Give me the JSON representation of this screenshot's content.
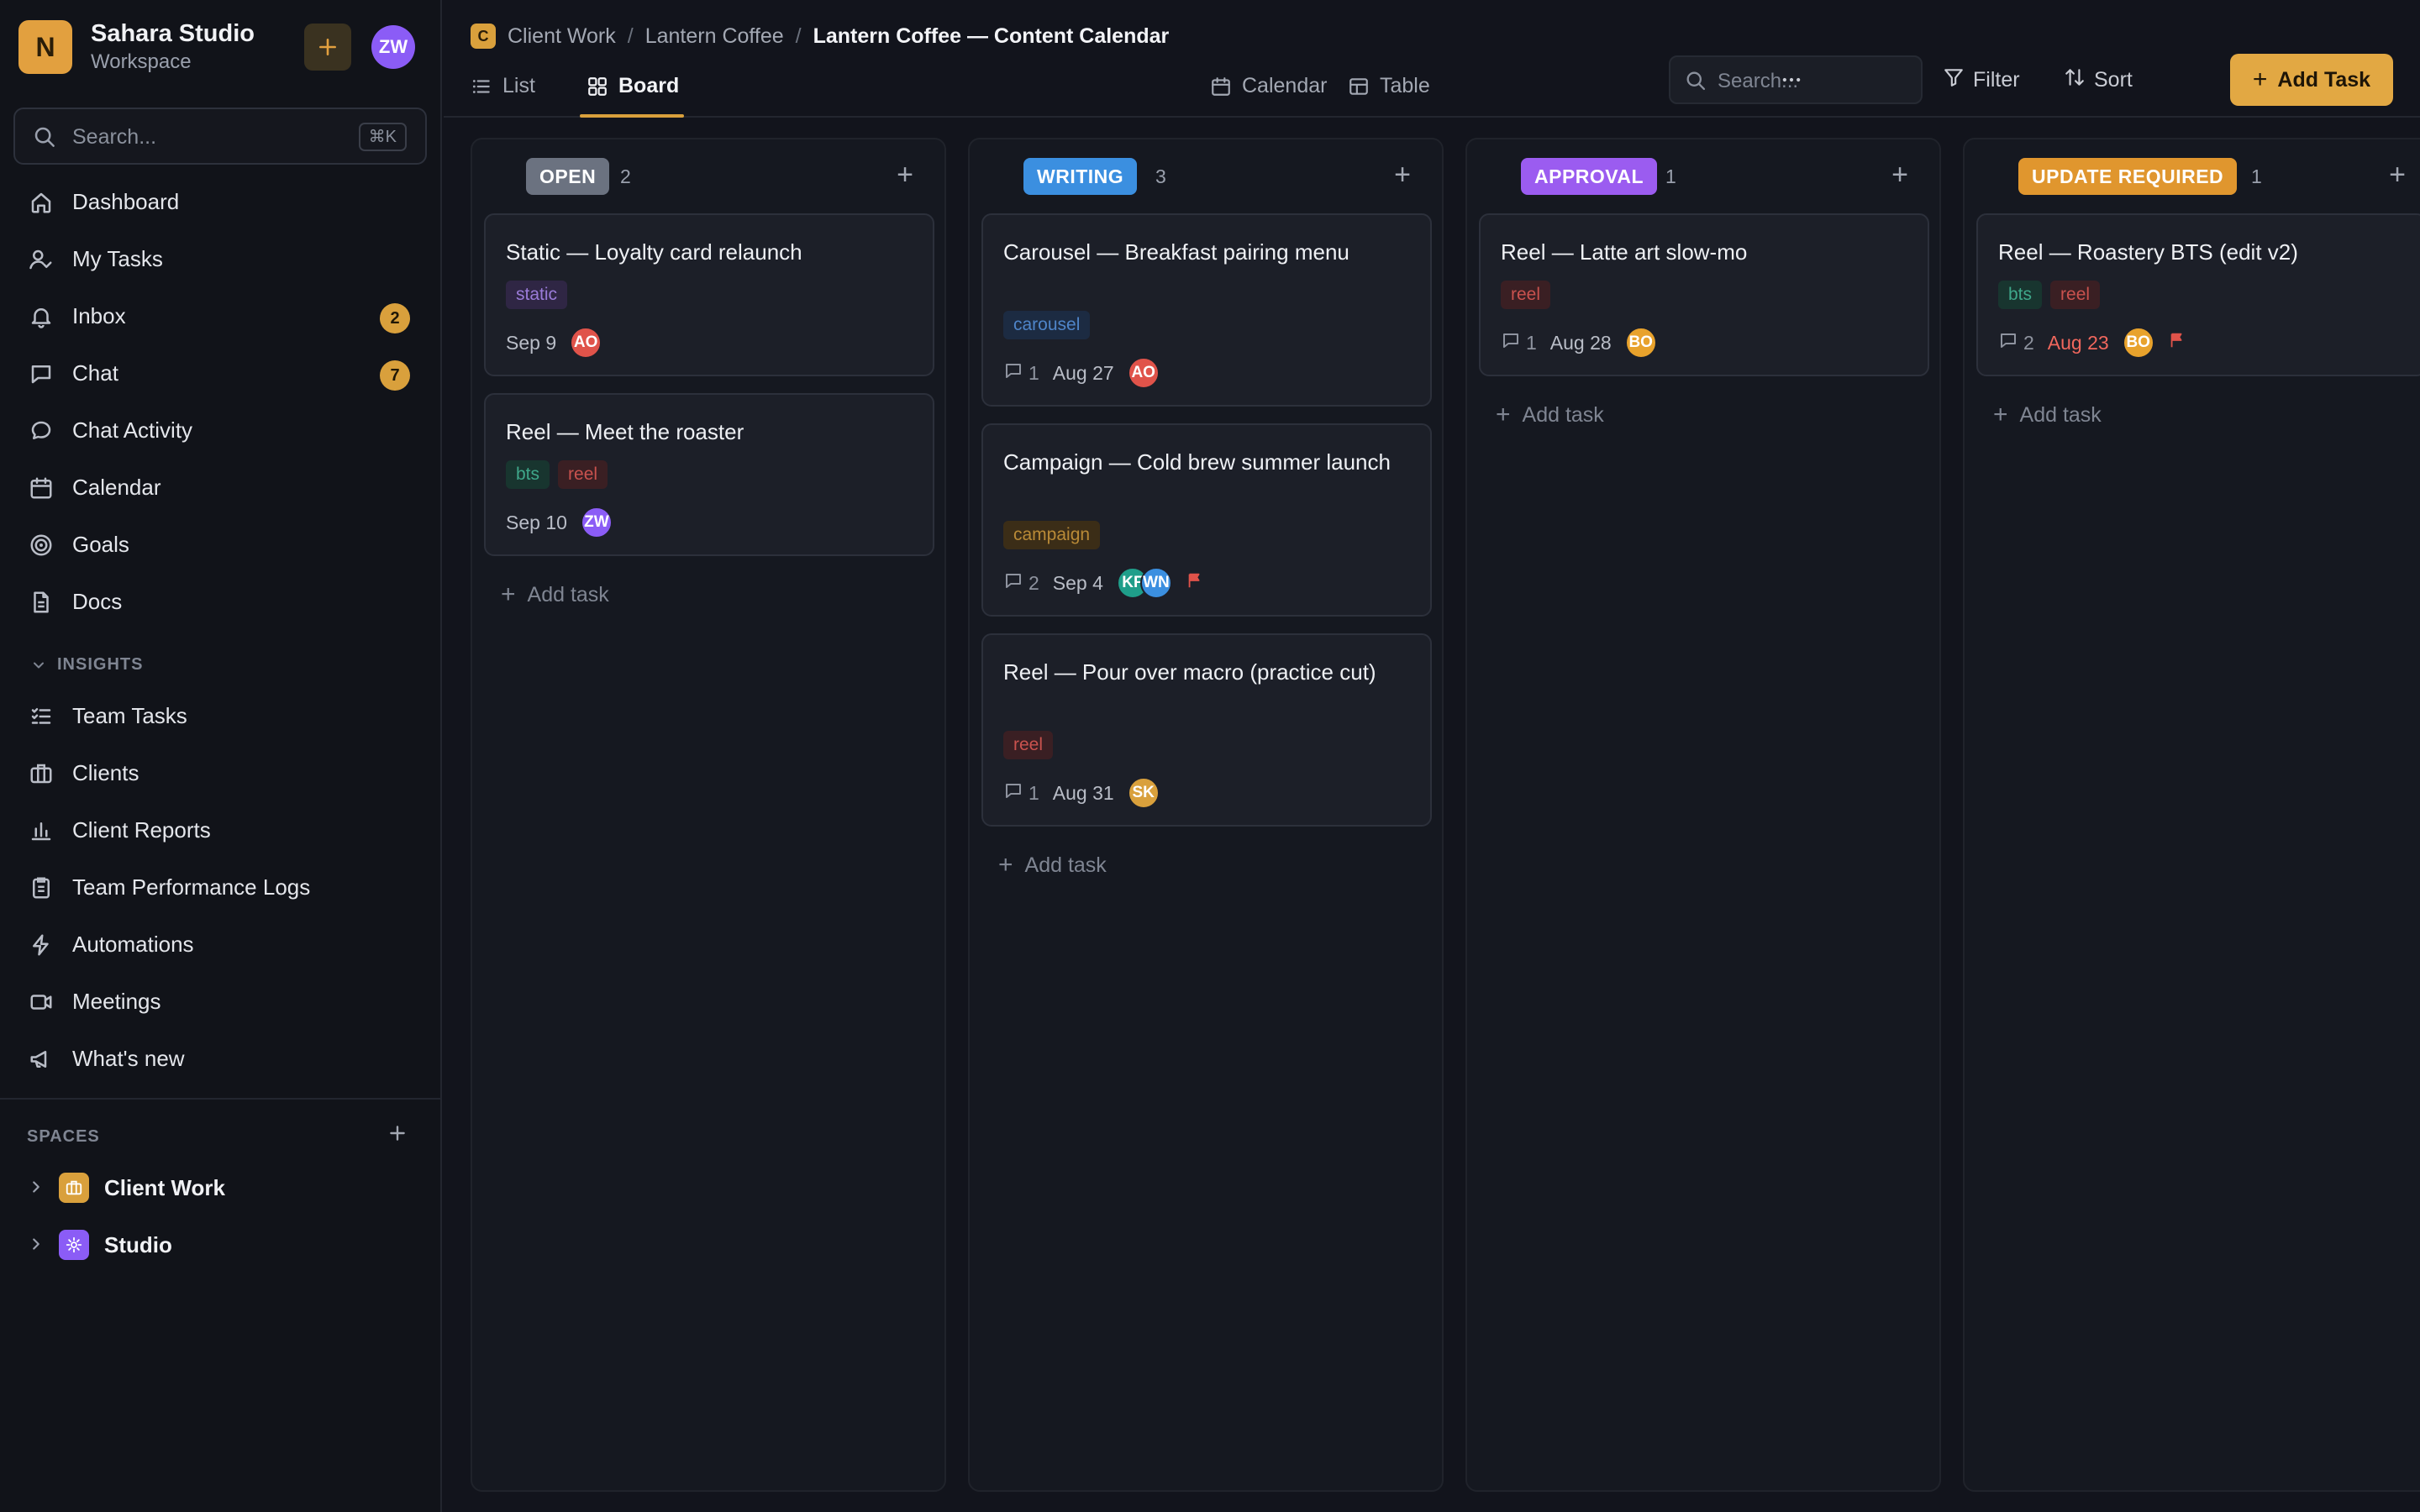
{
  "workspace": {
    "logo_letter": "N",
    "name": "Sahara Studio",
    "subtitle": "Workspace",
    "add_button_icon": "plus-icon",
    "user_initials": "ZW"
  },
  "sidebar": {
    "search_placeholder": "Search...",
    "search_shortcut": "⌘K",
    "items": [
      {
        "label": "Dashboard",
        "icon": "home-icon"
      },
      {
        "label": "My Tasks",
        "icon": "user-check-icon"
      },
      {
        "label": "Inbox",
        "icon": "bell-icon",
        "badge": "2"
      },
      {
        "label": "Chat",
        "icon": "chat-icon",
        "badge": "7"
      },
      {
        "label": "Chat Activity",
        "icon": "chat-bubble-icon"
      },
      {
        "label": "Calendar",
        "icon": "calendar-icon"
      },
      {
        "label": "Goals",
        "icon": "target-icon"
      },
      {
        "label": "Docs",
        "icon": "document-icon"
      }
    ],
    "insights_label": "INSIGHTS",
    "insights_items": [
      {
        "label": "Team Tasks",
        "icon": "task-list-icon"
      },
      {
        "label": "Clients",
        "icon": "briefcase-icon"
      },
      {
        "label": "Client Reports",
        "icon": "bar-chart-icon"
      },
      {
        "label": "Team Performance Logs",
        "icon": "clipboard-icon"
      },
      {
        "label": "Automations",
        "icon": "lightning-icon"
      },
      {
        "label": "Meetings",
        "icon": "video-icon"
      },
      {
        "label": "What's new",
        "icon": "megaphone-icon"
      }
    ],
    "spaces_label": "SPACES",
    "spaces": [
      {
        "label": "Client Work",
        "icon": "briefcase-icon",
        "color": "#d9a03c"
      },
      {
        "label": "Studio",
        "icon": "gear-icon",
        "color": "#8b5cf6"
      }
    ]
  },
  "header": {
    "breadcrumb": {
      "space_letter": "C",
      "items": [
        "Client Work",
        "Lantern Coffee"
      ],
      "current": "Lantern Coffee — Content Calendar"
    },
    "tabs": [
      {
        "label": "List",
        "icon": "list-icon"
      },
      {
        "label": "Board",
        "icon": "board-icon",
        "active": true
      },
      {
        "label": "Calendar",
        "icon": "calendar-icon"
      },
      {
        "label": "Table",
        "icon": "table-icon"
      }
    ],
    "search_placeholder": "Search...",
    "filter_label": "Filter",
    "sort_label": "Sort",
    "more_icon": "ellipsis-icon",
    "add_task_label": "Add Task"
  },
  "board": {
    "add_task_label": "Add task",
    "columns": [
      {
        "status": "OPEN",
        "count": "2",
        "color": "#6b7280",
        "cards": [
          {
            "title": "Static — Loyalty card relaunch",
            "tags": [
              "static"
            ],
            "comments": "",
            "date": "Sep 9",
            "assignees": [
              "AO"
            ]
          },
          {
            "title": "Reel — Meet the roaster",
            "tags": [
              "bts",
              "reel"
            ],
            "comments": "",
            "date": "Sep 10",
            "assignees": [
              "ZW"
            ]
          }
        ]
      },
      {
        "status": "WRITING",
        "count": "3",
        "color": "#3b8fe0",
        "cards": [
          {
            "title": "Carousel — Breakfast pairing menu",
            "tags": [
              "carousel"
            ],
            "comments": "1",
            "date": "Aug 27",
            "assignees": [
              "AO"
            ]
          },
          {
            "title": "Campaign — Cold brew summer launch",
            "tags": [
              "campaign"
            ],
            "comments": "2",
            "date": "Sep 4",
            "assignees": [
              "KF",
              "WN"
            ],
            "flag": true
          },
          {
            "title": "Reel — Pour over macro (practice cut)",
            "tags": [
              "reel"
            ],
            "comments": "1",
            "date": "Aug 31",
            "assignees": [
              "SK"
            ]
          }
        ]
      },
      {
        "status": "APPROVAL",
        "count": "1",
        "color": "#9b5cf0",
        "cards": [
          {
            "title": "Reel — Latte art slow-mo",
            "tags": [
              "reel"
            ],
            "comments": "1",
            "date": "Aug 28",
            "assignees": [
              "BO"
            ]
          }
        ]
      },
      {
        "status": "UPDATE REQUIRED",
        "count": "1",
        "color": "#e0962e",
        "cards": [
          {
            "title": "Reel — Roastery BTS (edit v2)",
            "tags": [
              "bts",
              "reel"
            ],
            "comments": "2",
            "date": "Aug 23",
            "date_overdue": true,
            "assignees": [
              "BO"
            ],
            "flag": true
          }
        ]
      }
    ]
  },
  "avatar_colors": {
    "AO": "#e0534a",
    "ZW": "#8b5cf6",
    "KF": "#1f9e8a",
    "WN": "#3b8fe0",
    "SK": "#d9a03c",
    "BO": "#e8a22c"
  }
}
